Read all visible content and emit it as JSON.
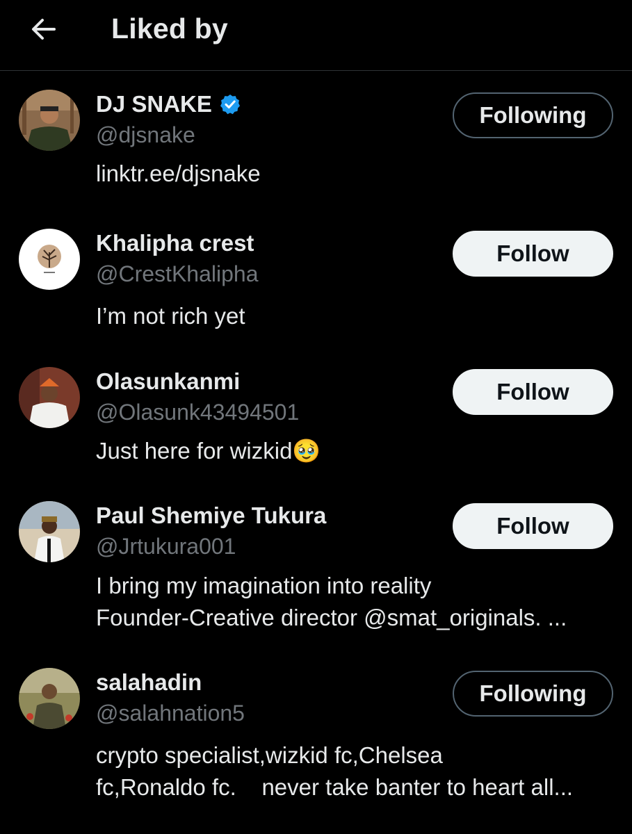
{
  "header": {
    "back_icon": "arrow-left-icon",
    "title": "Liked by"
  },
  "colors": {
    "background": "#000000",
    "primary_text": "#e7e9ea",
    "secondary_text": "#71767b",
    "verified_blue": "#1d9bf0",
    "follow_button_bg": "#eff3f4",
    "following_border": "#536471"
  },
  "users": [
    {
      "name": "DJ SNAKE",
      "verified": true,
      "handle": "@djsnake",
      "bio": [
        "linktr.ee/djsnake"
      ],
      "button": "Following"
    },
    {
      "name": "Khalipha crest",
      "verified": false,
      "handle": "@CrestKhalipha",
      "bio": [
        "I’m not rich yet"
      ],
      "button": "Follow"
    },
    {
      "name": "Olasunkanmi",
      "verified": false,
      "handle": "@Olasunk43494501",
      "bio": [
        "Just here for wizkid🥹"
      ],
      "button": "Follow"
    },
    {
      "name": "Paul Shemiye Tukura",
      "verified": false,
      "handle": "@Jrtukura001",
      "bio": [
        "I bring my imagination into reality",
        "Founder-Creative director @smat_originals. ..."
      ],
      "button": "Follow"
    },
    {
      "name": "salahadin",
      "verified": false,
      "handle": "@salahnation5",
      "bio": [
        "crypto specialist,wizkid fc,Chelsea",
        "fc,Ronaldo fc.    never take banter to heart all..."
      ],
      "button": "Following"
    }
  ]
}
